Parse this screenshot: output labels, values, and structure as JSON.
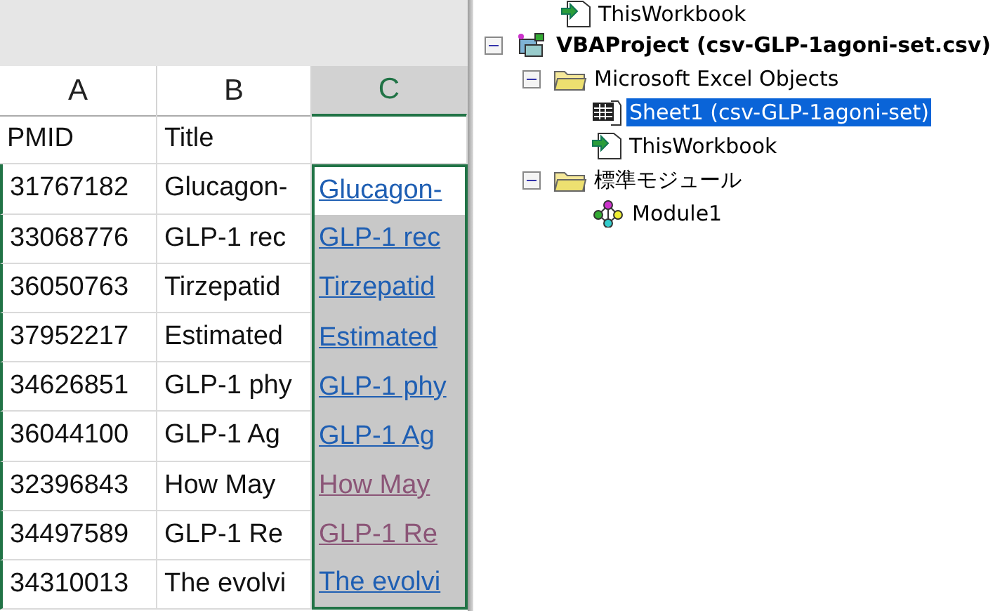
{
  "spreadsheet": {
    "columns": [
      {
        "label": "A",
        "selected": false
      },
      {
        "label": "B",
        "selected": false
      },
      {
        "label": "C",
        "selected": true
      }
    ],
    "header_row": {
      "col_a": "PMID",
      "col_b": "Title"
    },
    "rows": [
      {
        "pmid": "31767182",
        "title": "Glucagon-",
        "link": "Glucagon-",
        "visited": false,
        "active": true
      },
      {
        "pmid": "33068776",
        "title": "GLP-1 rec",
        "link": "GLP-1 rec",
        "visited": false,
        "active": false
      },
      {
        "pmid": "36050763",
        "title": "Tirzepatid",
        "link": "Tirzepatid",
        "visited": false,
        "active": false
      },
      {
        "pmid": "37952217",
        "title": "Estimated",
        "link": "Estimated",
        "visited": false,
        "active": false
      },
      {
        "pmid": "34626851",
        "title": "GLP-1 phy",
        "link": "GLP-1 phy",
        "visited": false,
        "active": false
      },
      {
        "pmid": "36044100",
        "title": "GLP-1 Ag",
        "link": "GLP-1 Ag",
        "visited": false,
        "active": false
      },
      {
        "pmid": "32396843",
        "title": "How May",
        "link": "How May",
        "visited": true,
        "active": false
      },
      {
        "pmid": "34497589",
        "title": "GLP-1 Re",
        "link": "GLP-1 Re",
        "visited": true,
        "active": false
      },
      {
        "pmid": "34310013",
        "title": "The evolvi",
        "link": "The evolvi",
        "visited": false,
        "active": false
      }
    ]
  },
  "project_explorer": {
    "clipped_item": {
      "label": "ThisWorkbook",
      "kind": "workbook"
    },
    "tree": [
      {
        "label": "VBAProject (csv-GLP-1agoni-set.csv)",
        "kind": "project",
        "expanded": true,
        "selected": false,
        "children": [
          {
            "label": "Microsoft Excel Objects",
            "kind": "folder",
            "expanded": true,
            "selected": false,
            "children": [
              {
                "label": "Sheet1 (csv-GLP-1agoni-set)",
                "kind": "sheet",
                "selected": true
              },
              {
                "label": "ThisWorkbook",
                "kind": "workbook",
                "selected": false
              }
            ]
          },
          {
            "label": "標準モジュール",
            "kind": "folder",
            "expanded": true,
            "selected": false,
            "children": [
              {
                "label": "Module1",
                "kind": "module",
                "selected": false
              }
            ]
          }
        ]
      }
    ]
  }
}
